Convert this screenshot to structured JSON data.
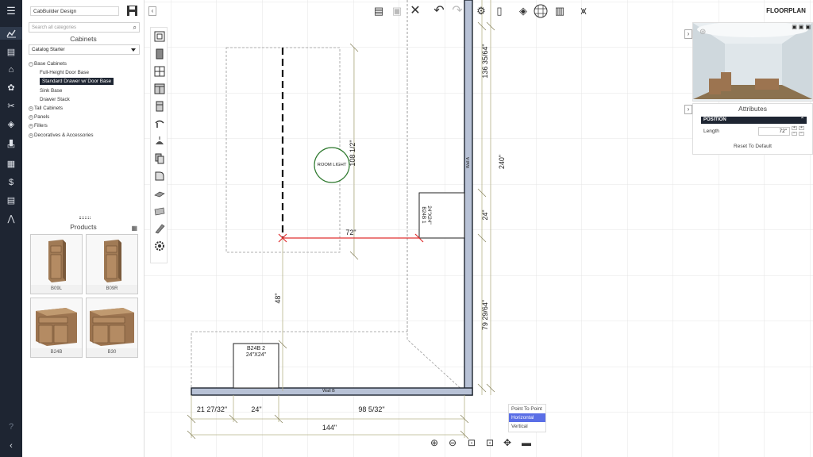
{
  "left_nav": {
    "icons": [
      "menu-icon",
      "chart-icon",
      "document-icon",
      "brush-icon",
      "palette-icon",
      "tools-icon",
      "layers-icon",
      "book-icon",
      "id-card-icon",
      "grid-icon",
      "dollar-icon",
      "report-icon",
      "compass-icon",
      "help-icon",
      "back-arrow-icon"
    ]
  },
  "catalog_panel": {
    "project_name": "CabBuilder Design",
    "search_placeholder": "Search all categories",
    "section_title": "Cabinets",
    "catalog_selected": "Catalog Starter",
    "tree": [
      {
        "label": "Base Cabinets",
        "expander": "⊖",
        "level": 0
      },
      {
        "label": "Full-Height Door Base",
        "level": 1
      },
      {
        "label": "Standard Drawer w/ Door Base",
        "level": 1,
        "selected": true
      },
      {
        "label": "Sink Base",
        "level": 1
      },
      {
        "label": "Drawer Stack",
        "level": 1
      },
      {
        "label": "Tall Cabinets",
        "expander": "⊕",
        "level": 0
      },
      {
        "label": "Panels",
        "expander": "⊕",
        "level": 0
      },
      {
        "label": "Fillers",
        "expander": "⊕",
        "level": 0
      },
      {
        "label": "Decoratives & Accessories",
        "expander": "⊕",
        "level": 0
      }
    ]
  },
  "products": {
    "title": "Products",
    "items": [
      {
        "label": "B09L"
      },
      {
        "label": "B09R"
      },
      {
        "label": "B24B"
      },
      {
        "label": "B30"
      }
    ]
  },
  "toolbar": {
    "view_title": "FLOORPLAN"
  },
  "canvas": {
    "dims": {
      "d_136": "136 35/64\"",
      "d_240": "240\"",
      "d_24v": "24\"",
      "d_79": "79 29/64\"",
      "d_108": "108 1/2\"",
      "d_72": "72\"",
      "d_48": "48\"",
      "d_21": "21 27/32\"",
      "d_24h": "24\"",
      "d_98": "98 5/32\"",
      "d_144": "144\""
    },
    "labels": {
      "light": "ROOM LIGHT",
      "wall_a": "Wall A",
      "wall_b": "Wall B",
      "cab1_line1": "B24B 2",
      "cab1_line2": "24\"X24\"",
      "cab2_line1": "24\"X24\"",
      "cab2_line2": "B24B 1"
    }
  },
  "attributes": {
    "title": "Attributes",
    "section": "POSITION",
    "length_label": "Length",
    "length_value": "72\"",
    "reset_label": "Reset To Default"
  },
  "snap_menu": {
    "options": [
      {
        "label": "Point To Point",
        "selected": false
      },
      {
        "label": "Horizontal",
        "selected": true
      },
      {
        "label": "Vertical",
        "selected": false
      }
    ]
  }
}
